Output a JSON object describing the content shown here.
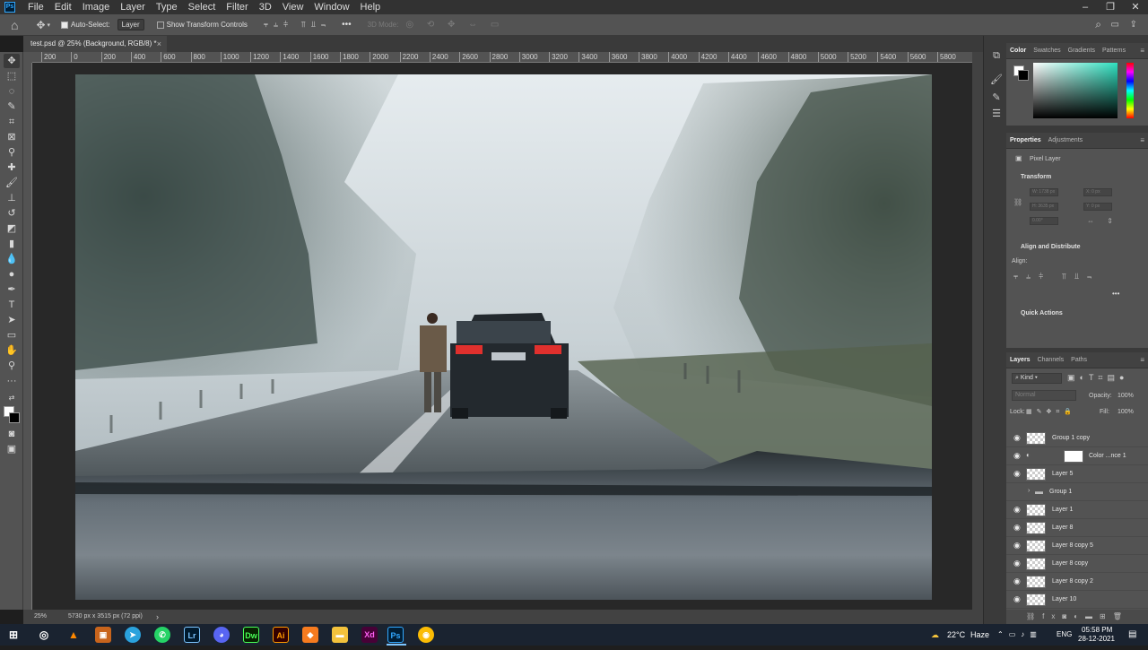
{
  "menubar": {
    "logo": "Ps",
    "items": [
      "File",
      "Edit",
      "Image",
      "Layer",
      "Type",
      "Select",
      "Filter",
      "3D",
      "View",
      "Window",
      "Help"
    ]
  },
  "options": {
    "auto_select_label": "Auto-Select:",
    "auto_select_value": "Layer",
    "show_transform_label": "Show Transform Controls",
    "mode_3d_label": "3D Mode:",
    "more": "•••"
  },
  "document": {
    "tab_title": "test.psd @ 25% (Background, RGB/8) *",
    "close": "×"
  },
  "ruler": {
    "ticks": [
      "200",
      "0",
      "200",
      "400",
      "600",
      "800",
      "1000",
      "1200",
      "1400",
      "1600",
      "1800",
      "2000",
      "2200",
      "2400",
      "2600",
      "2800",
      "3000",
      "3200",
      "3400",
      "3600",
      "3800",
      "4000",
      "4200",
      "4400",
      "4600",
      "4800",
      "5000",
      "5200",
      "5400",
      "5600",
      "5800"
    ]
  },
  "status": {
    "zoom": "25%",
    "doc_size": "5730 px x 3515 px (72 ppi)",
    "arrow": "›"
  },
  "color_panel": {
    "tabs": [
      "Color",
      "Swatches",
      "Gradients",
      "Patterns"
    ]
  },
  "properties_panel": {
    "tabs": [
      "Properties",
      "Adjustments"
    ],
    "type_label": "Pixel Layer",
    "transform_title": "Transform",
    "transform_fields": [
      "W: 1738 px",
      "X: 0 px",
      "H: 3635 px",
      "Y: 0 px",
      "0.00°"
    ],
    "align_title": "Align and Distribute",
    "align_label": "Align:",
    "quick_actions_title": "Quick Actions",
    "more": "•••"
  },
  "layers_panel": {
    "tabs": [
      "Layers",
      "Channels",
      "Paths"
    ],
    "filter_kind": "Kind",
    "blend_mode": "Normal",
    "opacity_label": "Opacity:",
    "opacity_value": "100%",
    "lock_label": "Lock:",
    "fill_label": "Fill:",
    "fill_value": "100%",
    "layers": [
      {
        "name": "Group 1 copy",
        "visible": true,
        "type": "pixel"
      },
      {
        "name": "Color ...nce 1",
        "visible": true,
        "type": "adjustment"
      },
      {
        "name": "Layer 5",
        "visible": true,
        "type": "pixel"
      },
      {
        "name": "Group 1",
        "visible": false,
        "type": "group"
      },
      {
        "name": "Layer 1",
        "visible": true,
        "type": "pixel"
      },
      {
        "name": "Layer 8",
        "visible": true,
        "type": "pixel"
      },
      {
        "name": "Layer 8 copy 5",
        "visible": true,
        "type": "pixel"
      },
      {
        "name": "Layer 8 copy",
        "visible": true,
        "type": "pixel"
      },
      {
        "name": "Layer 8 copy 2",
        "visible": true,
        "type": "pixel"
      },
      {
        "name": "Layer 10",
        "visible": true,
        "type": "pixel"
      }
    ]
  },
  "taskbar": {
    "weather_temp": "22°C",
    "weather_desc": "Haze",
    "lang": "ENG",
    "time": "05:58 PM",
    "date": "28-12-2021"
  }
}
